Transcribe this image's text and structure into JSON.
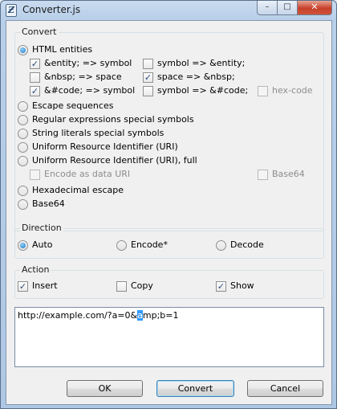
{
  "window": {
    "title": "Converter.js",
    "icon": "script-icon"
  },
  "convert": {
    "legend": "Convert",
    "html_entities": {
      "label": "HTML entities",
      "selected": true,
      "options": [
        {
          "label": "&entity; => symbol",
          "checked": true,
          "enabled": true
        },
        {
          "label": "symbol => &entity;",
          "checked": false,
          "enabled": true
        },
        {
          "label": "&nbsp; => space",
          "checked": false,
          "enabled": true
        },
        {
          "label": "space => &nbsp;",
          "checked": true,
          "enabled": true
        },
        {
          "label": "&#code; => symbol",
          "checked": true,
          "enabled": true
        },
        {
          "label": "symbol => &#code;",
          "checked": false,
          "enabled": true
        },
        {
          "label": "hex-code",
          "checked": false,
          "enabled": false
        }
      ]
    },
    "escape_sequences": {
      "label": "Escape sequences",
      "selected": false
    },
    "regex_symbols": {
      "label": "Regular expressions special symbols",
      "selected": false
    },
    "string_literals": {
      "label": "String literals special symbols",
      "selected": false
    },
    "uri": {
      "label": "Uniform Resource Identifier (URI)",
      "selected": false
    },
    "uri_full": {
      "label": "Uniform Resource Identifier (URI), full",
      "selected": false
    },
    "data_uri": {
      "label": "Encode as data URI",
      "checked": false,
      "enabled": false
    },
    "base64_sub": {
      "label": "Base64",
      "checked": false,
      "enabled": false
    },
    "hex_escape": {
      "label": "Hexadecimal escape",
      "selected": false
    },
    "base64": {
      "label": "Base64",
      "selected": false
    }
  },
  "direction": {
    "legend": "Direction",
    "auto": {
      "label": "Auto",
      "selected": true
    },
    "encode": {
      "label": "Encode*",
      "selected": false
    },
    "decode": {
      "label": "Decode",
      "selected": false
    }
  },
  "action": {
    "legend": "Action",
    "insert": {
      "label": "Insert",
      "checked": true
    },
    "copy": {
      "label": "Copy",
      "checked": false
    },
    "show": {
      "label": "Show",
      "checked": true
    }
  },
  "text": {
    "before": "http://example.com/?a=0&",
    "selected": "a",
    "after": "mp;b=1"
  },
  "buttons": {
    "ok": "OK",
    "convert": "Convert",
    "cancel": "Cancel"
  },
  "caption": {
    "minimize": "–",
    "maximize": "□",
    "close": "✕"
  },
  "colors": {
    "selection": "#3399ff",
    "title_bar": "#b8cfe9",
    "close_button": "#c6402a"
  }
}
